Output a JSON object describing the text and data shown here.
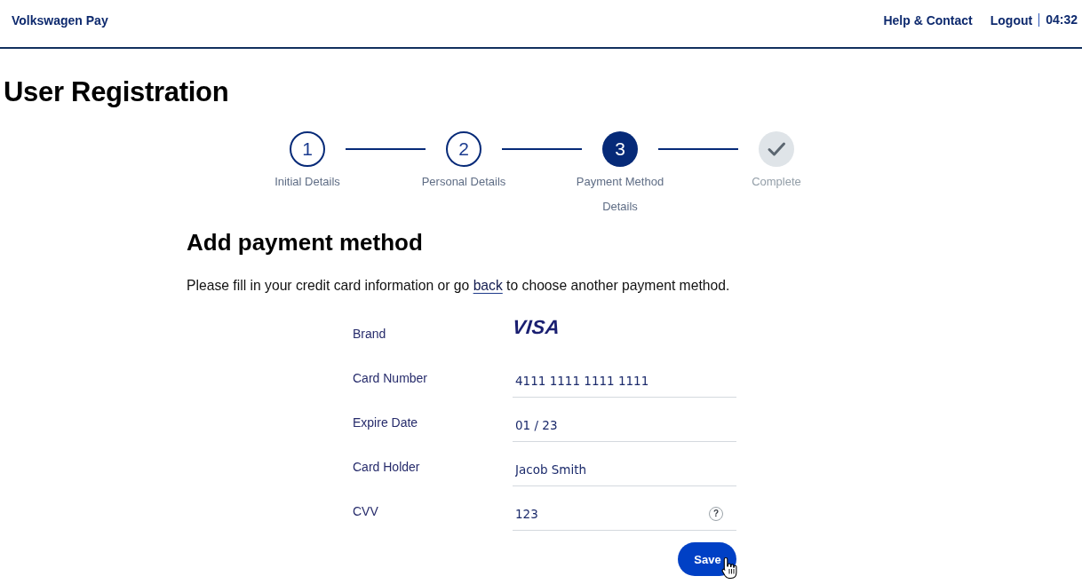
{
  "header": {
    "brand": "Volkswagen Pay",
    "links": [
      "Help & Contact",
      "Logout"
    ],
    "timer": "04:32"
  },
  "page_title": "User Registration",
  "stepper": {
    "steps": [
      {
        "kind": "number",
        "number": "1",
        "label": "Initial Details",
        "selected": false
      },
      {
        "kind": "number",
        "number": "2",
        "label": "Personal Details",
        "selected": false
      },
      {
        "kind": "number",
        "number": "3",
        "label": "Payment Method Details",
        "selected": true
      },
      {
        "kind": "check",
        "label": "Complete",
        "selected": false
      }
    ]
  },
  "section": {
    "heading": "Add payment method",
    "intro": {
      "before": "Please fill in your credit card information or go",
      "link": "back",
      "after": "to choose another payment method."
    },
    "fields": [
      {
        "kind": "logo",
        "label": "Brand",
        "value": "VISA"
      },
      {
        "kind": "input",
        "label": "Card Number",
        "value": "4111 1111 1111 1111"
      },
      {
        "kind": "input",
        "label": "Expire Date",
        "value": "01 / 23"
      },
      {
        "kind": "input",
        "label": "Card Holder",
        "value": "Jacob Smith"
      },
      {
        "kind": "input",
        "label": "CVV",
        "value": "123",
        "help": "?"
      }
    ],
    "submit": "Save"
  }
}
